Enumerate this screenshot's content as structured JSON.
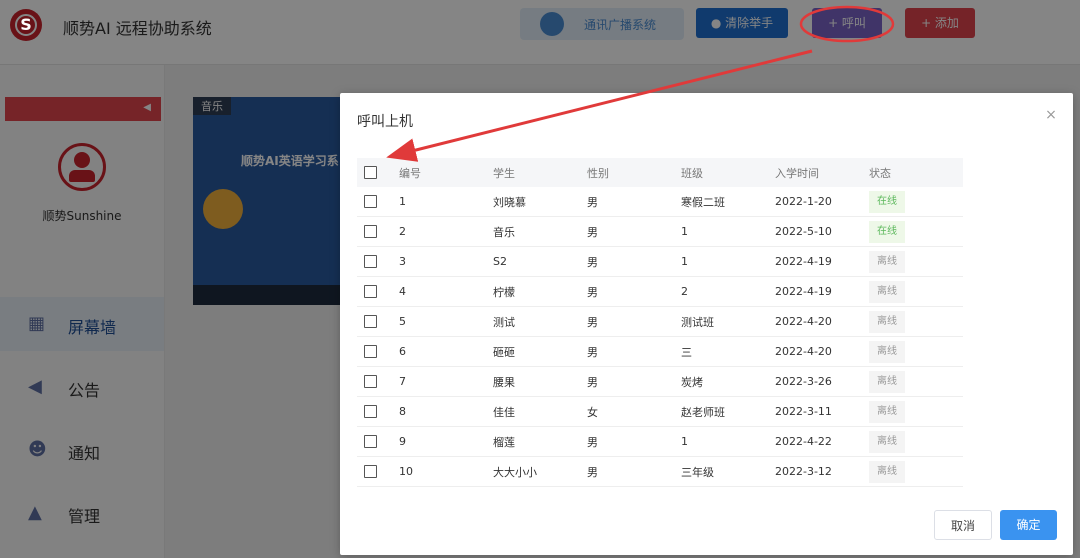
{
  "app": {
    "logo_letter": "S",
    "title": "顺势AI 远程协助系统"
  },
  "toolbar": {
    "broadcast_label": "通讯广播系统",
    "clear_hand_label": "清除举手",
    "call_label": "+ 呼叫",
    "add_label": "+ 添加"
  },
  "sidebar": {
    "collapse_icon": "◀",
    "user_name": "顺势Sunshine",
    "items": [
      {
        "label": "屏幕墙",
        "icon": "screen-wall-icon",
        "active": true
      },
      {
        "label": "公告",
        "icon": "megaphone-icon",
        "active": false
      },
      {
        "label": "通知",
        "icon": "users-icon",
        "active": false
      },
      {
        "label": "管理",
        "icon": "graduation-cap-icon",
        "active": false
      }
    ]
  },
  "tile": {
    "tag": "音乐",
    "text": "顺势AI英语学习系"
  },
  "modal": {
    "title": "呼叫上机",
    "close_icon": "×",
    "columns": [
      "编号",
      "学生",
      "性别",
      "班级",
      "入学时间",
      "状态"
    ],
    "rows": [
      {
        "no": "1",
        "student": "刘晓慕",
        "gender": "男",
        "class": "寒假二班",
        "date": "2022-1-20",
        "status": "在线",
        "online": true
      },
      {
        "no": "2",
        "student": "音乐",
        "gender": "男",
        "class": "1",
        "date": "2022-5-10",
        "status": "在线",
        "online": true
      },
      {
        "no": "3",
        "student": "S2",
        "gender": "男",
        "class": "1",
        "date": "2022-4-19",
        "status": "离线",
        "online": false
      },
      {
        "no": "4",
        "student": "柠檬",
        "gender": "男",
        "class": "2",
        "date": "2022-4-19",
        "status": "离线",
        "online": false
      },
      {
        "no": "5",
        "student": "测试",
        "gender": "男",
        "class": "测试班",
        "date": "2022-4-20",
        "status": "离线",
        "online": false
      },
      {
        "no": "6",
        "student": "砸砸",
        "gender": "男",
        "class": "三",
        "date": "2022-4-20",
        "status": "离线",
        "online": false
      },
      {
        "no": "7",
        "student": "腰果",
        "gender": "男",
        "class": "炭烤",
        "date": "2022-3-26",
        "status": "离线",
        "online": false
      },
      {
        "no": "8",
        "student": "佳佳",
        "gender": "女",
        "class": "赵老师班",
        "date": "2022-3-11",
        "status": "离线",
        "online": false
      },
      {
        "no": "9",
        "student": "榴莲",
        "gender": "男",
        "class": "1",
        "date": "2022-4-22",
        "status": "离线",
        "online": false
      },
      {
        "no": "10",
        "student": "大大小小",
        "gender": "男",
        "class": "三年级",
        "date": "2022-3-12",
        "status": "离线",
        "online": false
      }
    ],
    "cancel_label": "取消",
    "ok_label": "确定"
  },
  "colors": {
    "brand_red": "#c9242d",
    "primary_blue": "#3a93f0",
    "online_green": "#5cb85c",
    "annotation_red": "#e03a3a"
  }
}
